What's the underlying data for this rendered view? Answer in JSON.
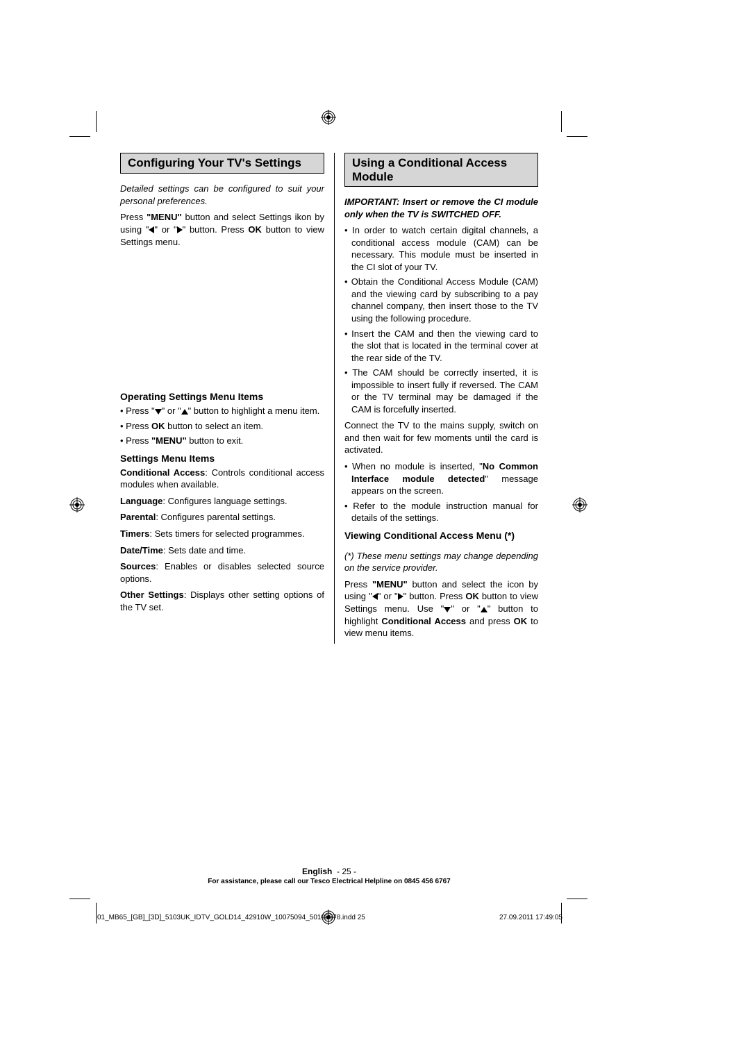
{
  "left": {
    "title": "Conﬁguring Your TV's Settings",
    "intro_italic": "Detailed settings can be configured to suit your personal preferences.",
    "press_para_pre": "Press ",
    "menu_bold": "\"MENU\"",
    "press_para_mid1": " button and select Settings ikon by using \"",
    "press_para_mid2": "\" or \"",
    "press_para_mid3": "\" button. Press ",
    "ok_bold": "OK",
    "press_para_end": " button to view Settings menu.",
    "op_head": "Operating Settings Menu Items",
    "op_b1_pre": "Press \"",
    "op_b1_mid": "\" or \"",
    "op_b1_end": "\" button to highlight a menu item.",
    "op_b2_pre": "Press ",
    "op_b2_end": " button to select an item.",
    "op_b3_pre": "Press ",
    "op_b3_end": " button to exit.",
    "sm_head": "Settings Menu Items",
    "sm_ca_label": "Conditional Access",
    "sm_ca_text": ": Controls conditional access modules when available.",
    "sm_lang_label": "Language",
    "sm_lang_text": ": Conﬁgures language settings.",
    "sm_par_label": "Parental",
    "sm_par_text": ": Conﬁgures parental settings.",
    "sm_tim_label": "Timers",
    "sm_tim_text": ": Sets timers for selected programmes.",
    "sm_dt_label": "Date/Time",
    "sm_dt_text": ": Sets date and time.",
    "sm_src_label": "Sources",
    "sm_src_text": ": Enables or disables selected source options.",
    "sm_oth_label": "Other Settings",
    "sm_oth_text": ": Displays other setting options of the TV set."
  },
  "right": {
    "title": "Using a Conditional Access Module",
    "important": "IMPORTANT: Insert or remove the CI module only when the TV is SWITCHED OFF.",
    "b1": "In order to watch certain digital channels, a conditional access module (CAM) can be necessary. This module must be inserted in the CI slot of your TV.",
    "b2": "Obtain the Conditional Access Module (CAM) and the viewing card by subscribing to a pay channel company, then insert those to the TV using the following procedure.",
    "b3": "Insert the CAM and then the viewing card to the slot that is located in the terminal cover at the rear side of the TV.",
    "b4": "The CAM should be correctly inserted, it is impossible to insert fully if reversed. The CAM or the TV terminal may be damaged if the CAM is forcefully inserted.",
    "connect": "Connect the TV to the mains supply, switch on and then wait for few moments until the card is activated.",
    "b5_pre": "When no module is inserted, \"",
    "b5_bold": "No Common Interface module detected",
    "b5_end": "\" message appears on the screen.",
    "b6": "Refer to the module instruction manual for details of the settings.",
    "vca_head": "Viewing Conditional Access Menu (*)",
    "vca_note": "(*) These menu settings may change depending on the service provider.",
    "vca_p_pre": "Press ",
    "vca_p_mid1": " button and select the icon by using \"",
    "vca_p_mid2": "\" or \"",
    "vca_p_mid3": "\" button. Press ",
    "vca_p_mid4": " button to view Settings menu. Use \"",
    "vca_p_mid5": "\" or \"",
    "vca_p_mid6": "\" button to highlight ",
    "vca_ca_bold": "Conditional Access",
    "vca_p_mid7": " and press ",
    "vca_p_end": " to view menu items."
  },
  "footer": {
    "lang": "English",
    "page": "- 25 -",
    "help": "For assistance, please call our Tesco Electrical Helpline on 0845 456 6767"
  },
  "print": {
    "file": "01_MB65_[GB]_[3D]_5103UK_IDTV_GOLD14_42910W_10075094_50198878.indd   25",
    "stamp": "27.09.2011   17:49:05"
  }
}
